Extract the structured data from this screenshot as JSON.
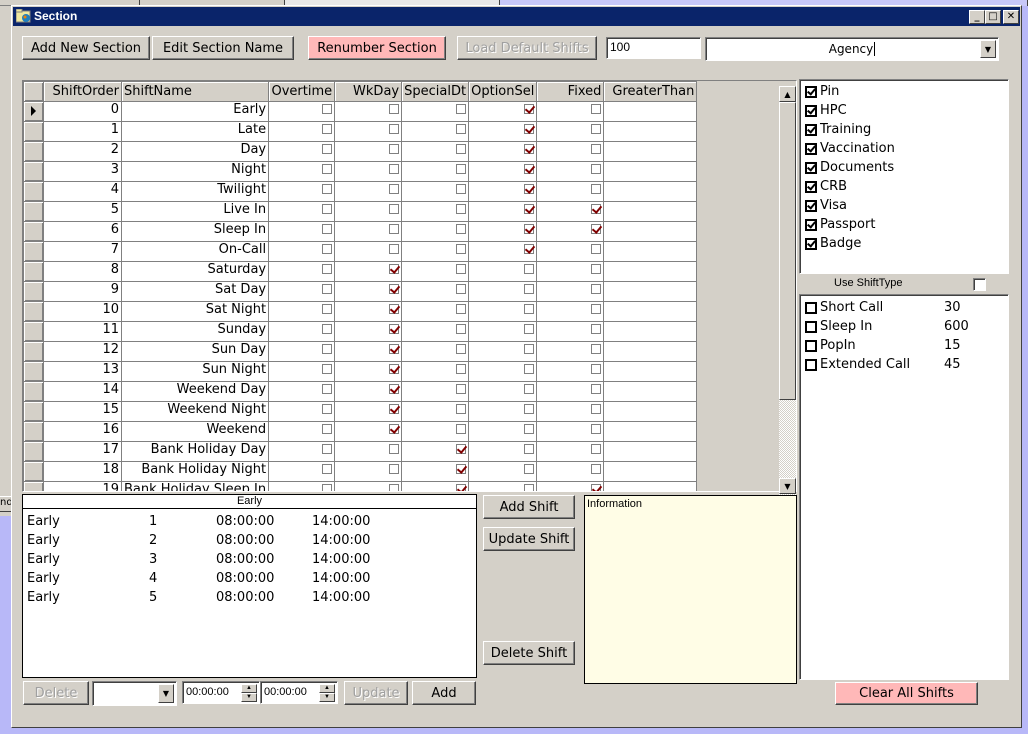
{
  "window": {
    "title": "Section",
    "controls": {
      "minimize": "_",
      "maximize": "□",
      "close": "✕"
    }
  },
  "toolbar": {
    "add_new_section": "Add New Section",
    "edit_section_name": "Edit Section Name",
    "renumber_section": "Renumber Section",
    "load_default_shifts": "Load Default Shifts",
    "number_value": "100",
    "agency_value": "Agency"
  },
  "grid": {
    "columns": [
      "ShiftOrder",
      "ShiftName",
      "Overtime",
      "WkDay",
      "SpecialDt",
      "OptionSel",
      "Fixed",
      "GreaterThan"
    ],
    "rows": [
      {
        "order": "0",
        "name": "Early",
        "overtime": false,
        "wkday": false,
        "specialdt": false,
        "optionsel": true,
        "fixed": false,
        "greaterthan": ""
      },
      {
        "order": "1",
        "name": "Late",
        "overtime": false,
        "wkday": false,
        "specialdt": false,
        "optionsel": true,
        "fixed": false,
        "greaterthan": ""
      },
      {
        "order": "2",
        "name": "Day",
        "overtime": false,
        "wkday": false,
        "specialdt": false,
        "optionsel": true,
        "fixed": false,
        "greaterthan": ""
      },
      {
        "order": "3",
        "name": "Night",
        "overtime": false,
        "wkday": false,
        "specialdt": false,
        "optionsel": true,
        "fixed": false,
        "greaterthan": ""
      },
      {
        "order": "4",
        "name": "Twilight",
        "overtime": false,
        "wkday": false,
        "specialdt": false,
        "optionsel": true,
        "fixed": false,
        "greaterthan": ""
      },
      {
        "order": "5",
        "name": "Live In",
        "overtime": false,
        "wkday": false,
        "specialdt": false,
        "optionsel": true,
        "fixed": true,
        "greaterthan": ""
      },
      {
        "order": "6",
        "name": "Sleep In",
        "overtime": false,
        "wkday": false,
        "specialdt": false,
        "optionsel": true,
        "fixed": true,
        "greaterthan": ""
      },
      {
        "order": "7",
        "name": "On-Call",
        "overtime": false,
        "wkday": false,
        "specialdt": false,
        "optionsel": true,
        "fixed": false,
        "greaterthan": ""
      },
      {
        "order": "8",
        "name": "Saturday",
        "overtime": false,
        "wkday": true,
        "specialdt": false,
        "optionsel": false,
        "fixed": false,
        "greaterthan": ""
      },
      {
        "order": "9",
        "name": "Sat Day",
        "overtime": false,
        "wkday": true,
        "specialdt": false,
        "optionsel": false,
        "fixed": false,
        "greaterthan": ""
      },
      {
        "order": "10",
        "name": "Sat Night",
        "overtime": false,
        "wkday": true,
        "specialdt": false,
        "optionsel": false,
        "fixed": false,
        "greaterthan": ""
      },
      {
        "order": "11",
        "name": "Sunday",
        "overtime": false,
        "wkday": true,
        "specialdt": false,
        "optionsel": false,
        "fixed": false,
        "greaterthan": ""
      },
      {
        "order": "12",
        "name": "Sun Day",
        "overtime": false,
        "wkday": true,
        "specialdt": false,
        "optionsel": false,
        "fixed": false,
        "greaterthan": ""
      },
      {
        "order": "13",
        "name": "Sun Night",
        "overtime": false,
        "wkday": true,
        "specialdt": false,
        "optionsel": false,
        "fixed": false,
        "greaterthan": ""
      },
      {
        "order": "14",
        "name": "Weekend Day",
        "overtime": false,
        "wkday": true,
        "specialdt": false,
        "optionsel": false,
        "fixed": false,
        "greaterthan": ""
      },
      {
        "order": "15",
        "name": "Weekend Night",
        "overtime": false,
        "wkday": true,
        "specialdt": false,
        "optionsel": false,
        "fixed": false,
        "greaterthan": ""
      },
      {
        "order": "16",
        "name": "Weekend",
        "overtime": false,
        "wkday": true,
        "specialdt": false,
        "optionsel": false,
        "fixed": false,
        "greaterthan": ""
      },
      {
        "order": "17",
        "name": "Bank Holiday Day",
        "overtime": false,
        "wkday": false,
        "specialdt": true,
        "optionsel": false,
        "fixed": false,
        "greaterthan": ""
      },
      {
        "order": "18",
        "name": "Bank Holiday Night",
        "overtime": false,
        "wkday": false,
        "specialdt": true,
        "optionsel": false,
        "fixed": false,
        "greaterthan": ""
      },
      {
        "order": "19",
        "name": "Bank Holiday Sleep In",
        "overtime": false,
        "wkday": false,
        "specialdt": true,
        "optionsel": false,
        "fixed": true,
        "greaterthan": ""
      }
    ],
    "current_row": 0
  },
  "requirements": {
    "items": [
      {
        "label": "Pin",
        "checked": true
      },
      {
        "label": "HPC",
        "checked": true
      },
      {
        "label": "Training",
        "checked": true
      },
      {
        "label": "Vaccination",
        "checked": true
      },
      {
        "label": "Documents",
        "checked": true
      },
      {
        "label": "CRB",
        "checked": true
      },
      {
        "label": "Visa",
        "checked": true
      },
      {
        "label": "Passport",
        "checked": true
      },
      {
        "label": "Badge",
        "checked": true
      }
    ]
  },
  "use_shift_type": {
    "label": "Use ShiftType",
    "checked": false
  },
  "shift_types": {
    "items": [
      {
        "label": "Short Call",
        "value": "30",
        "checked": false
      },
      {
        "label": "Sleep In",
        "value": "600",
        "checked": false
      },
      {
        "label": "PopIn",
        "value": "15",
        "checked": false
      },
      {
        "label": "Extended Call",
        "value": "45",
        "checked": false
      }
    ]
  },
  "shift_list": {
    "header": "Early",
    "rows": [
      {
        "name": "Early",
        "day": "1",
        "start": "08:00:00",
        "end": "14:00:00"
      },
      {
        "name": "Early",
        "day": "2",
        "start": "08:00:00",
        "end": "14:00:00"
      },
      {
        "name": "Early",
        "day": "3",
        "start": "08:00:00",
        "end": "14:00:00"
      },
      {
        "name": "Early",
        "day": "4",
        "start": "08:00:00",
        "end": "14:00:00"
      },
      {
        "name": "Early",
        "day": "5",
        "start": "08:00:00",
        "end": "14:00:00"
      }
    ]
  },
  "shift_buttons": {
    "add_shift": "Add Shift",
    "update_shift": "Update Shift",
    "delete_shift": "Delete Shift"
  },
  "information": {
    "label": "Information"
  },
  "bottom_bar": {
    "delete": "Delete",
    "day_select_value": "",
    "start_time": "00:00:00",
    "end_time": "00:00:00",
    "update": "Update",
    "add": "Add"
  },
  "clear_all_shifts": "Clear All Shifts",
  "background": {
    "tab_fragment": "nd"
  }
}
